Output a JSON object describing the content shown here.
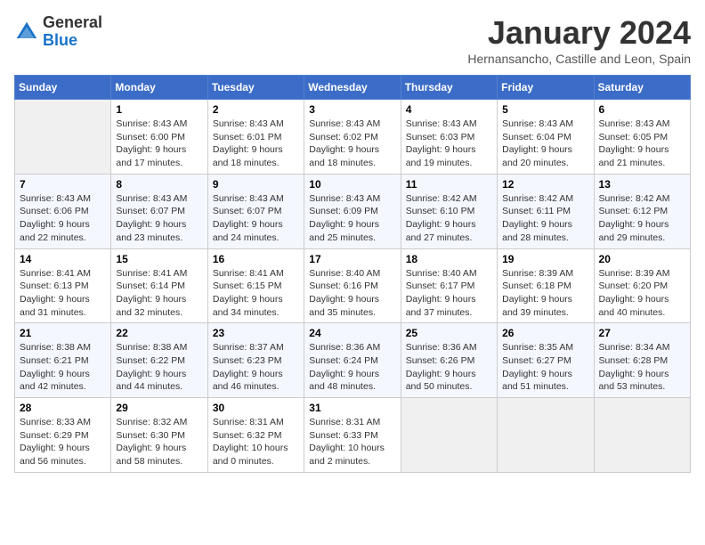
{
  "header": {
    "logo": {
      "line1": "General",
      "line2": "Blue"
    },
    "title": "January 2024",
    "subtitle": "Hernansancho, Castille and Leon, Spain"
  },
  "days_of_week": [
    "Sunday",
    "Monday",
    "Tuesday",
    "Wednesday",
    "Thursday",
    "Friday",
    "Saturday"
  ],
  "weeks": [
    [
      {
        "day": "",
        "sunrise": "",
        "sunset": "",
        "daylight": ""
      },
      {
        "day": "1",
        "sunrise": "Sunrise: 8:43 AM",
        "sunset": "Sunset: 6:00 PM",
        "daylight": "Daylight: 9 hours and 17 minutes."
      },
      {
        "day": "2",
        "sunrise": "Sunrise: 8:43 AM",
        "sunset": "Sunset: 6:01 PM",
        "daylight": "Daylight: 9 hours and 18 minutes."
      },
      {
        "day": "3",
        "sunrise": "Sunrise: 8:43 AM",
        "sunset": "Sunset: 6:02 PM",
        "daylight": "Daylight: 9 hours and 18 minutes."
      },
      {
        "day": "4",
        "sunrise": "Sunrise: 8:43 AM",
        "sunset": "Sunset: 6:03 PM",
        "daylight": "Daylight: 9 hours and 19 minutes."
      },
      {
        "day": "5",
        "sunrise": "Sunrise: 8:43 AM",
        "sunset": "Sunset: 6:04 PM",
        "daylight": "Daylight: 9 hours and 20 minutes."
      },
      {
        "day": "6",
        "sunrise": "Sunrise: 8:43 AM",
        "sunset": "Sunset: 6:05 PM",
        "daylight": "Daylight: 9 hours and 21 minutes."
      }
    ],
    [
      {
        "day": "7",
        "sunrise": "Sunrise: 8:43 AM",
        "sunset": "Sunset: 6:06 PM",
        "daylight": "Daylight: 9 hours and 22 minutes."
      },
      {
        "day": "8",
        "sunrise": "Sunrise: 8:43 AM",
        "sunset": "Sunset: 6:07 PM",
        "daylight": "Daylight: 9 hours and 23 minutes."
      },
      {
        "day": "9",
        "sunrise": "Sunrise: 8:43 AM",
        "sunset": "Sunset: 6:07 PM",
        "daylight": "Daylight: 9 hours and 24 minutes."
      },
      {
        "day": "10",
        "sunrise": "Sunrise: 8:43 AM",
        "sunset": "Sunset: 6:09 PM",
        "daylight": "Daylight: 9 hours and 25 minutes."
      },
      {
        "day": "11",
        "sunrise": "Sunrise: 8:42 AM",
        "sunset": "Sunset: 6:10 PM",
        "daylight": "Daylight: 9 hours and 27 minutes."
      },
      {
        "day": "12",
        "sunrise": "Sunrise: 8:42 AM",
        "sunset": "Sunset: 6:11 PM",
        "daylight": "Daylight: 9 hours and 28 minutes."
      },
      {
        "day": "13",
        "sunrise": "Sunrise: 8:42 AM",
        "sunset": "Sunset: 6:12 PM",
        "daylight": "Daylight: 9 hours and 29 minutes."
      }
    ],
    [
      {
        "day": "14",
        "sunrise": "Sunrise: 8:41 AM",
        "sunset": "Sunset: 6:13 PM",
        "daylight": "Daylight: 9 hours and 31 minutes."
      },
      {
        "day": "15",
        "sunrise": "Sunrise: 8:41 AM",
        "sunset": "Sunset: 6:14 PM",
        "daylight": "Daylight: 9 hours and 32 minutes."
      },
      {
        "day": "16",
        "sunrise": "Sunrise: 8:41 AM",
        "sunset": "Sunset: 6:15 PM",
        "daylight": "Daylight: 9 hours and 34 minutes."
      },
      {
        "day": "17",
        "sunrise": "Sunrise: 8:40 AM",
        "sunset": "Sunset: 6:16 PM",
        "daylight": "Daylight: 9 hours and 35 minutes."
      },
      {
        "day": "18",
        "sunrise": "Sunrise: 8:40 AM",
        "sunset": "Sunset: 6:17 PM",
        "daylight": "Daylight: 9 hours and 37 minutes."
      },
      {
        "day": "19",
        "sunrise": "Sunrise: 8:39 AM",
        "sunset": "Sunset: 6:18 PM",
        "daylight": "Daylight: 9 hours and 39 minutes."
      },
      {
        "day": "20",
        "sunrise": "Sunrise: 8:39 AM",
        "sunset": "Sunset: 6:20 PM",
        "daylight": "Daylight: 9 hours and 40 minutes."
      }
    ],
    [
      {
        "day": "21",
        "sunrise": "Sunrise: 8:38 AM",
        "sunset": "Sunset: 6:21 PM",
        "daylight": "Daylight: 9 hours and 42 minutes."
      },
      {
        "day": "22",
        "sunrise": "Sunrise: 8:38 AM",
        "sunset": "Sunset: 6:22 PM",
        "daylight": "Daylight: 9 hours and 44 minutes."
      },
      {
        "day": "23",
        "sunrise": "Sunrise: 8:37 AM",
        "sunset": "Sunset: 6:23 PM",
        "daylight": "Daylight: 9 hours and 46 minutes."
      },
      {
        "day": "24",
        "sunrise": "Sunrise: 8:36 AM",
        "sunset": "Sunset: 6:24 PM",
        "daylight": "Daylight: 9 hours and 48 minutes."
      },
      {
        "day": "25",
        "sunrise": "Sunrise: 8:36 AM",
        "sunset": "Sunset: 6:26 PM",
        "daylight": "Daylight: 9 hours and 50 minutes."
      },
      {
        "day": "26",
        "sunrise": "Sunrise: 8:35 AM",
        "sunset": "Sunset: 6:27 PM",
        "daylight": "Daylight: 9 hours and 51 minutes."
      },
      {
        "day": "27",
        "sunrise": "Sunrise: 8:34 AM",
        "sunset": "Sunset: 6:28 PM",
        "daylight": "Daylight: 9 hours and 53 minutes."
      }
    ],
    [
      {
        "day": "28",
        "sunrise": "Sunrise: 8:33 AM",
        "sunset": "Sunset: 6:29 PM",
        "daylight": "Daylight: 9 hours and 56 minutes."
      },
      {
        "day": "29",
        "sunrise": "Sunrise: 8:32 AM",
        "sunset": "Sunset: 6:30 PM",
        "daylight": "Daylight: 9 hours and 58 minutes."
      },
      {
        "day": "30",
        "sunrise": "Sunrise: 8:31 AM",
        "sunset": "Sunset: 6:32 PM",
        "daylight": "Daylight: 10 hours and 0 minutes."
      },
      {
        "day": "31",
        "sunrise": "Sunrise: 8:31 AM",
        "sunset": "Sunset: 6:33 PM",
        "daylight": "Daylight: 10 hours and 2 minutes."
      },
      {
        "day": "",
        "sunrise": "",
        "sunset": "",
        "daylight": ""
      },
      {
        "day": "",
        "sunrise": "",
        "sunset": "",
        "daylight": ""
      },
      {
        "day": "",
        "sunrise": "",
        "sunset": "",
        "daylight": ""
      }
    ]
  ]
}
